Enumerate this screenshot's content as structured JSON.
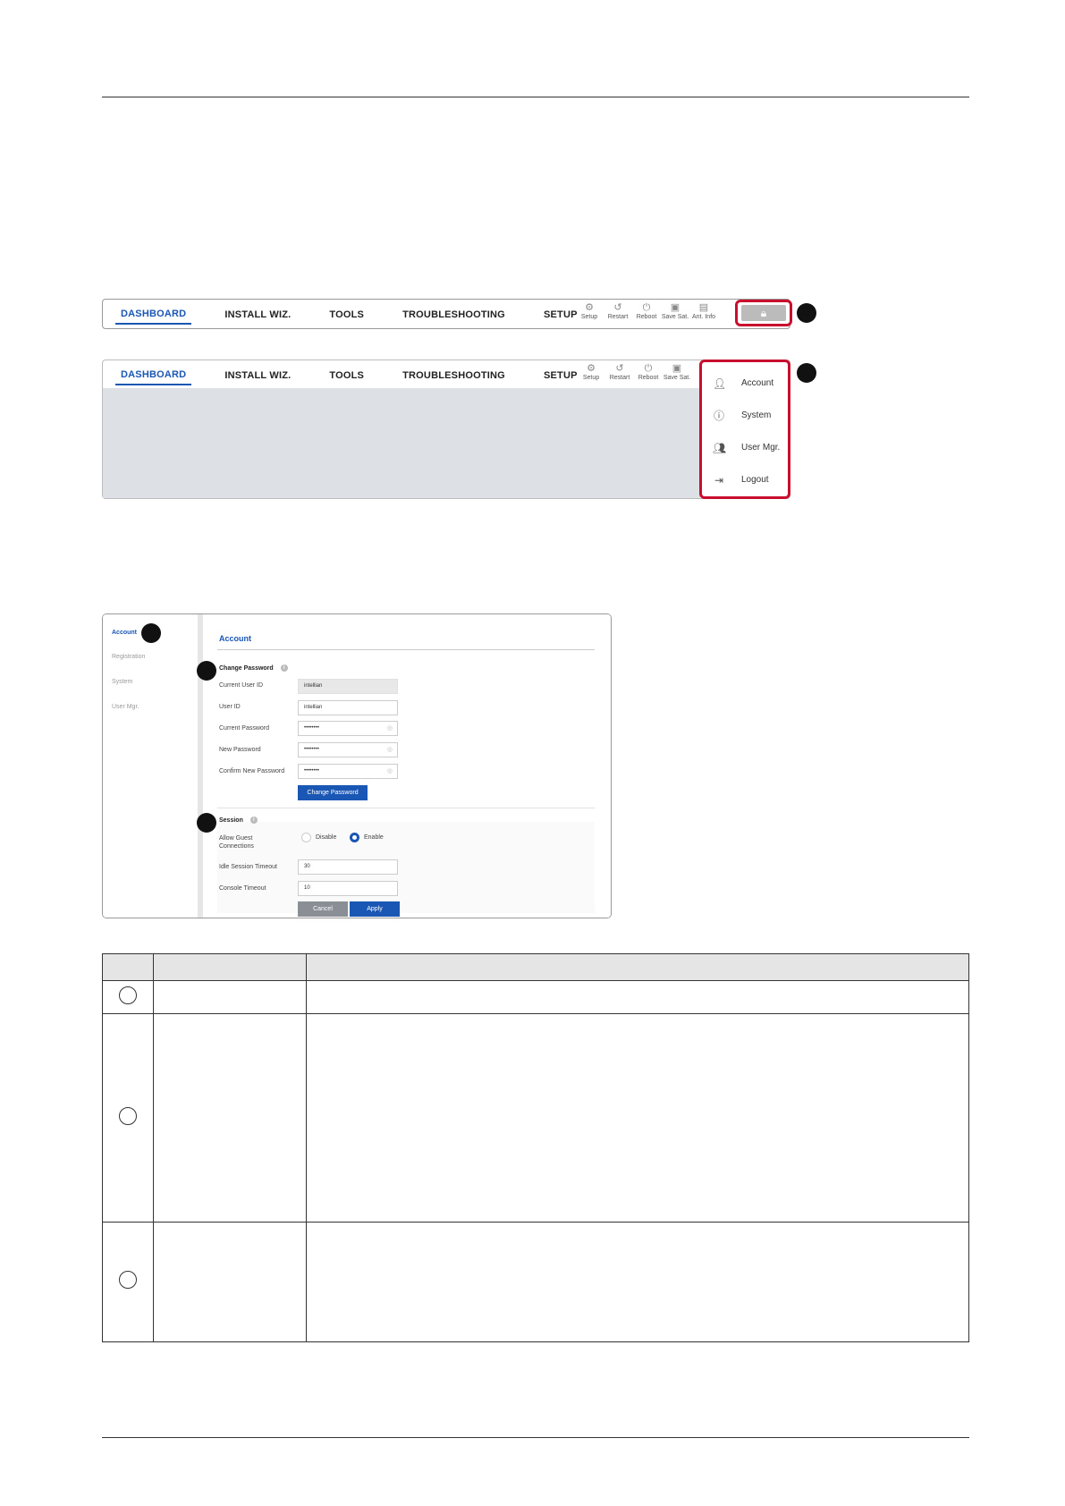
{
  "nav": {
    "tabs": [
      "DASHBOARD",
      "INSTALL WIZ.",
      "TOOLS",
      "TROUBLESHOOTING",
      "SETUP"
    ],
    "tools": [
      {
        "label": "Setup",
        "icon": "gear-icon"
      },
      {
        "label": "Restart",
        "icon": "restart-icon"
      },
      {
        "label": "Reboot",
        "icon": "power-icon"
      },
      {
        "label": "Save Sat.",
        "icon": "save-icon"
      },
      {
        "label": "Ant. Info",
        "icon": "antenna-info-icon"
      }
    ],
    "lock_icon": "lock-icon"
  },
  "user_menu": {
    "items": [
      {
        "label": "Account",
        "icon": "person-icon"
      },
      {
        "label": "System",
        "icon": "info-icon"
      },
      {
        "label": "User Mgr.",
        "icon": "users-icon"
      },
      {
        "label": "Logout",
        "icon": "logout-icon"
      }
    ]
  },
  "account_panel": {
    "sidebar": [
      "Account",
      "Registration",
      "System",
      "User Mgr."
    ],
    "title": "Account",
    "change_password": {
      "heading": "Change Password",
      "fields": [
        {
          "label": "Current User ID",
          "value": "intellian"
        },
        {
          "label": "User ID",
          "value": "intellian"
        },
        {
          "label": "Current Password",
          "value": "••••••••"
        },
        {
          "label": "New Password",
          "value": "••••••••"
        },
        {
          "label": "Confirm New Password",
          "value": "••••••••"
        }
      ],
      "button": "Change Password"
    },
    "session": {
      "heading": "Session",
      "guest_label_1": "Allow Guest",
      "guest_label_2": "Connections",
      "disable_label": "Disable",
      "enable_label": "Enable",
      "idle_label": "Idle Session Timeout",
      "idle_value": "30",
      "console_label": "Console Timeout",
      "console_value": "10",
      "cancel": "Cancel",
      "apply": "Apply"
    }
  },
  "colors": {
    "accent": "#1a56b4",
    "highlight": "#c8102e"
  }
}
